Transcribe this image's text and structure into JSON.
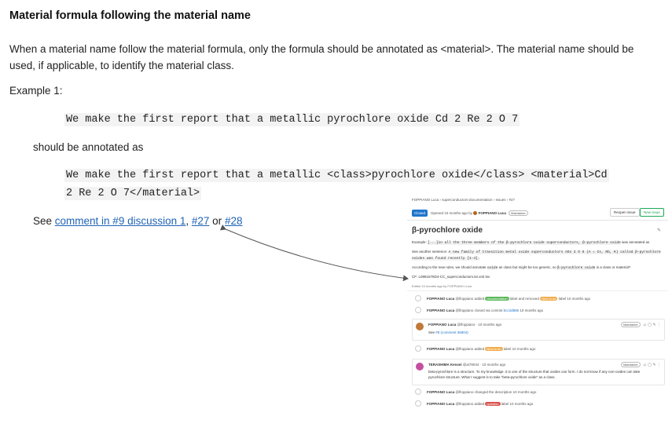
{
  "doc": {
    "heading": "Material formula following the material name",
    "paragraph": "When a material name follow the material formula, only the formula should be annotated as <material>. The material name should be used, if applicable, to identify the material class.",
    "example_label": "Example 1:",
    "code_example": "We make the first report that a metallic pyrochlore oxide Cd 2 Re 2 O 7",
    "annotated_label": "should be annotated as",
    "code_annotated_line1": "We make the first report that a metallic <class>pyrochlore oxide</class> <material>Cd",
    "code_annotated_line2": "2 Re 2 O 7</material>",
    "see_prefix": "See ",
    "see_link1": "comment in #9 discussion 1",
    "see_comma": ", ",
    "see_link2": "#27",
    "see_or": " or ",
    "see_link3": "#28"
  },
  "gitlab": {
    "breadcrumb": "FOPPIANO Luca  ›  superconductors-documentation  ›  Issues  ›  #27",
    "status_badge": "Closed",
    "opened_text": "Opened 10 months ago by",
    "author": "FOPPIANO Luca",
    "role": "Maintainer",
    "reopen_button": "Reopen issue",
    "new_issue_button": "New issue",
    "title": "β-pyrochlore oxide",
    "desc_line1_prefix": "Example: ",
    "desc_line1_code": "[...]in all the three members of the β-pyrochlore oxide superconductors, β-pyrochlore oxide",
    "desc_line1_suffix": " was annotated as",
    "desc_line2_prefix": "See another sentence: ",
    "desc_line2_code": "A new family of transition metal oxide superconductors AOs 2 O 6 (A = Cs, Rb, K) called β-pyrochlore oxides was found recently [1-4].",
    "desc_line3_a": "According to the new rules, we should annotate ",
    "desc_line3_code1": "oxide",
    "desc_line3_b": " as class but might be too generic, so ",
    "desc_line3_code2": "β-pyrochlore oxide",
    "desc_line3_c": " is a class or material?",
    "desc_line4": "CF: L0861676D4-CC_superconductors.tei.xml.tsv",
    "edited": "Edited 10 months ago by FOPPIANO Luca",
    "act1_user": "FOPPIANO Luca",
    "act1_text_a": " @lfoppiano added ",
    "act1_label1": "documentation",
    "act1_text_b": " label and removed ",
    "act1_label2": "Next to do",
    "act1_text_c": " label 10 months ago",
    "act2_user": "FOPPIANO Luca",
    "act2_text_a": " @lfoppiano closed via commit ",
    "act2_commit": "bcc2d586",
    "act2_text_b": " 10 months ago",
    "note1_user": "FOPPIANO Luca",
    "note1_meta": " @lfoppiano · 10 months ago",
    "note1_role": "Maintainer",
    "note1_body_prefix": "See ",
    "note1_body_link": "#9 (comment 36804)",
    "act3_user": "FOPPIANO Luca",
    "act3_text_a": " @lfoppiano added ",
    "act3_label": "Next to do",
    "act3_text_b": " label 10 months ago",
    "note2_user": "TERASHIMA Kensei",
    "note2_meta": " @ai78044 · 10 months ago",
    "note2_role": "Maintainer",
    "note2_body": "beta-pyrochlore is a structure. To my knowledge, it is one of the structure that oxides can form. I do not know if any non-oxides can take pyrochlore structure. What I suggest is to take \"beta-pyrochlore oxide\" as a class.",
    "act4_user": "FOPPIANO Luca",
    "act4_text": " @lfoppiano changed the description 10 months ago",
    "act5_user": "FOPPIANO Luca",
    "act5_text_a": " @lfoppiano added ",
    "act5_label": "question",
    "act5_text_b": " label 10 months ago",
    "colors": {
      "closed": "#1f75cb",
      "documentation_label": "#5cb85c",
      "next_to_do_label": "#f0ad4e",
      "question_label": "#d9534f",
      "link": "#1f63b5"
    }
  }
}
